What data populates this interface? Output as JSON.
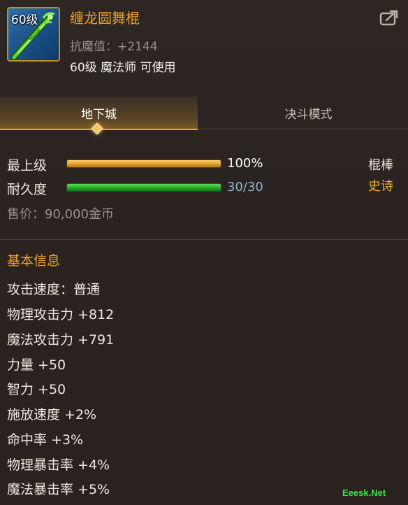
{
  "item": {
    "level_badge": "60级",
    "name": "缠龙圆舞棍",
    "sub_attr": "抗魔值：+2144",
    "requirement": "60级 魔法师 可使用",
    "icon": "green-dragon-staff-icon"
  },
  "tabs": [
    {
      "label": "地下城",
      "active": true
    },
    {
      "label": "决斗模式",
      "active": false
    }
  ],
  "grade": {
    "label": "最上级",
    "value_text": "100%",
    "fill": 1.0
  },
  "durability": {
    "label": "耐久度",
    "value_text": "30/30",
    "fill": 1.0
  },
  "weapon_type": "棍棒",
  "rarity": "史诗",
  "price": "售价：90,000金币",
  "section_title": "基本信息",
  "stats": [
    "攻击速度：普通",
    "物理攻击力 +812",
    "魔法攻击力 +791",
    "力量 +50",
    "智力 +50",
    "施放速度 +2%",
    "命中率 +3%",
    "物理暴击率 +4%",
    "魔法暴击率 +5%"
  ],
  "watermark": "Eeesk.Net",
  "colors": {
    "name": "#f0a62a",
    "rarity": "#f0b12c",
    "grade_value": "#ffffff",
    "durability_value": "#8fb3d9"
  }
}
